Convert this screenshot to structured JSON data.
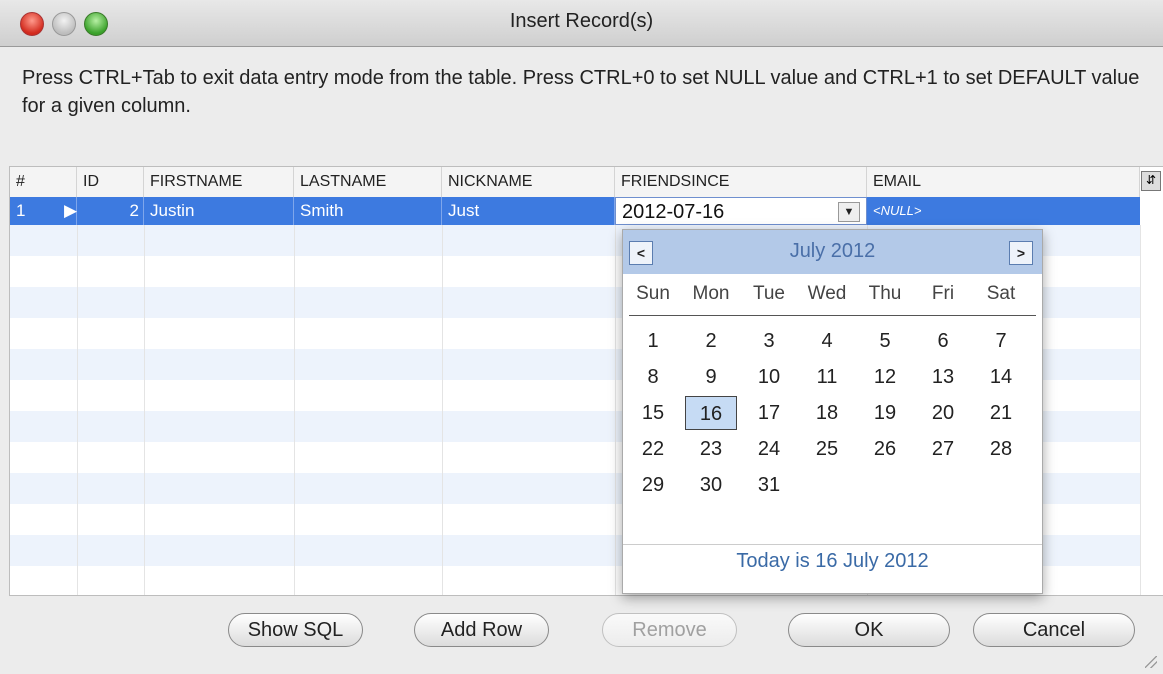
{
  "window": {
    "title": "Insert Record(s)"
  },
  "instructions": "Press CTRL+Tab to exit data entry mode from the table. Press CTRL+0 to set NULL value and CTRL+1 to set DEFAULT value for a given column.",
  "table": {
    "columns": [
      "#",
      "ID",
      "FIRSTNAME",
      "LASTNAME",
      "NICKNAME",
      "FRIENDSINCE",
      "EMAIL"
    ],
    "rows": [
      {
        "num": "1",
        "id": "2",
        "firstname": "Justin",
        "lastname": "Smith",
        "nickname": "Just",
        "friendsince": "2012-07-16",
        "email": "<NULL>"
      }
    ]
  },
  "calendar": {
    "month_title": "July 2012",
    "prev_label": "<",
    "next_label": ">",
    "weekdays": [
      "Sun",
      "Mon",
      "Tue",
      "Wed",
      "Thu",
      "Fri",
      "Sat"
    ],
    "selected_day": 16,
    "weeks": [
      [
        "1",
        "2",
        "3",
        "4",
        "5",
        "6",
        "7"
      ],
      [
        "8",
        "9",
        "10",
        "11",
        "12",
        "13",
        "14"
      ],
      [
        "15",
        "16",
        "17",
        "18",
        "19",
        "20",
        "21"
      ],
      [
        "22",
        "23",
        "24",
        "25",
        "26",
        "27",
        "28"
      ],
      [
        "29",
        "30",
        "31",
        "",
        "",
        "",
        ""
      ]
    ],
    "today_text": "Today is  16 July 2012"
  },
  "buttons": {
    "show_sql": "Show SQL",
    "add_row": "Add Row",
    "remove": "Remove",
    "ok": "OK",
    "cancel": "Cancel"
  },
  "colors": {
    "selection": "#3d7ae0",
    "calendar_header": "#b3c9e8"
  }
}
